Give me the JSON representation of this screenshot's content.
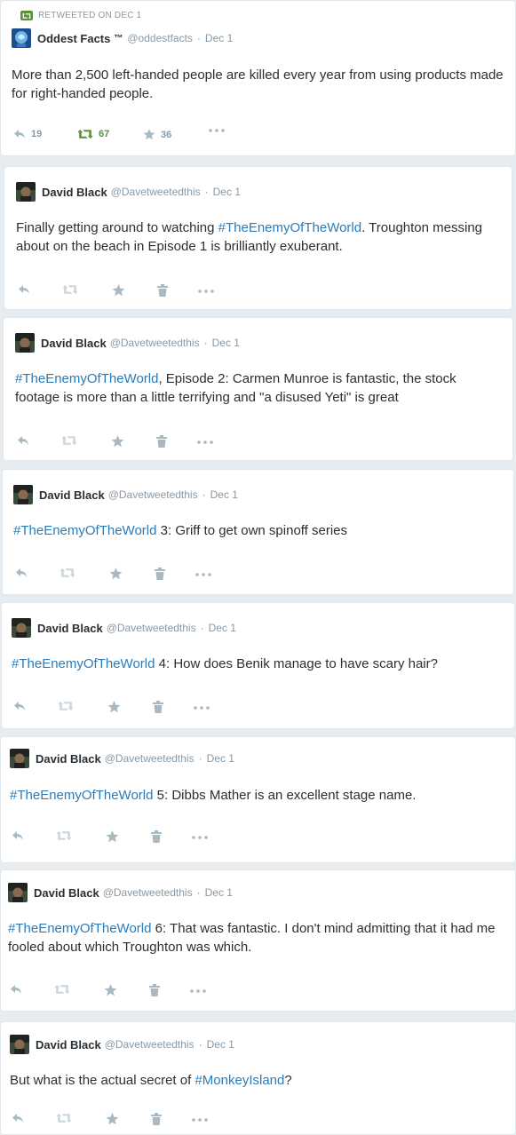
{
  "colors": {
    "background": "#e6ecf0",
    "card": "#ffffff",
    "hashtag": "#2b7bb9",
    "muted": "#8899a6",
    "retweet_green": "#5c913b",
    "text": "#292f33"
  },
  "icons": {
    "reply": "reply-icon",
    "retweet": "retweet-icon",
    "favorite": "star-icon",
    "delete": "trash-icon",
    "more": "more-icon"
  },
  "retweeted": {
    "label": "RETWEETED ON DEC 1",
    "name": "Oddest Facts",
    "badge": "™",
    "handle": "@oddestfacts",
    "sep": "·",
    "date": "Dec 1",
    "text": "More than 2,500 left-handed people are killed every year from using products made for right-handed people.",
    "replies": "19",
    "retweets": "67",
    "favorites": "36"
  },
  "tweets": [
    {
      "name": "David Black",
      "handle": "@Davetweetedthis",
      "sep": "·",
      "date": "Dec 1",
      "pre": "Finally getting around to watching ",
      "tag": "#TheEnemyOfTheWorld",
      "post": ". Troughton messing about on the beach in Episode 1 is brilliantly exuberant."
    },
    {
      "name": "David Black",
      "handle": "@Davetweetedthis",
      "sep": "·",
      "date": "Dec 1",
      "pre": "",
      "tag": "#TheEnemyOfTheWorld",
      "post": ", Episode 2: Carmen Munroe is fantastic, the stock footage is more than a little terrifying and \"a disused Yeti\" is great"
    },
    {
      "name": "David Black",
      "handle": "@Davetweetedthis",
      "sep": "·",
      "date": "Dec 1",
      "pre": "",
      "tag": "#TheEnemyOfTheWorld",
      "post": " 3: Griff to get own spinoff series"
    },
    {
      "name": "David Black",
      "handle": "@Davetweetedthis",
      "sep": "·",
      "date": "Dec 1",
      "pre": "",
      "tag": "#TheEnemyOfTheWorld",
      "post": " 4: How does Benik manage to have scary hair?"
    },
    {
      "name": "David Black",
      "handle": "@Davetweetedthis",
      "sep": "·",
      "date": "Dec 1",
      "pre": "",
      "tag": "#TheEnemyOfTheWorld",
      "post": " 5: Dibbs Mather is an excellent stage name."
    },
    {
      "name": "David Black",
      "handle": "@Davetweetedthis",
      "sep": "·",
      "date": "Dec 1",
      "pre": "",
      "tag": "#TheEnemyOfTheWorld",
      "post": " 6: That was fantastic. I don't mind admitting that it had me fooled about which Troughton was which."
    },
    {
      "name": "David Black",
      "handle": "@Davetweetedthis",
      "sep": "·",
      "date": "Dec 1",
      "pre": "But what is the actual secret of ",
      "tag": "#MonkeyIsland",
      "post": "?"
    }
  ]
}
